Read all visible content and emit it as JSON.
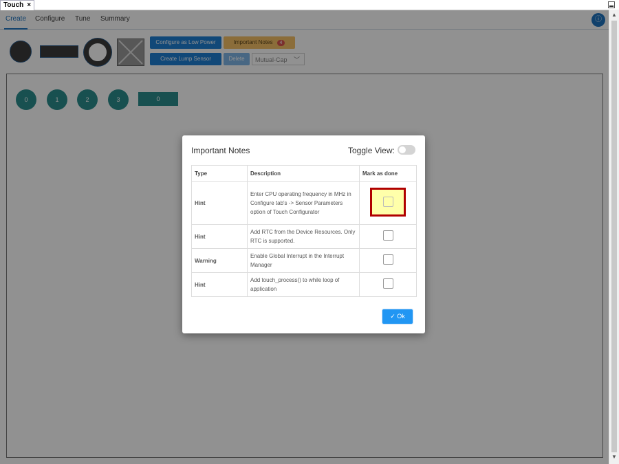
{
  "window": {
    "tab_title": "Touch",
    "tab_close": "×"
  },
  "nav": {
    "tabs": [
      {
        "label": "Create"
      },
      {
        "label": "Configure"
      },
      {
        "label": "Tune"
      },
      {
        "label": "Summary"
      }
    ],
    "active_tab": "Create",
    "info_icon": "ⓘ"
  },
  "toolbar": {
    "configure_low_power": "Configure as Low Power",
    "important_notes": "Important Notes",
    "important_notes_count": "4",
    "create_lump_sensor": "Create Lump Sensor",
    "delete": "Delete",
    "sensor_type": "Mutual-Cap",
    "shapes": [
      "button-sensor-icon",
      "slider-sensor-icon",
      "wheel-sensor-icon",
      "surface-sensor-icon"
    ]
  },
  "canvas": {
    "nodes": [
      "0",
      "1",
      "2",
      "3"
    ],
    "slider_label": "0"
  },
  "modal": {
    "title": "Important Notes",
    "toggle_label": "Toggle View:",
    "columns": [
      "Type",
      "Description",
      "Mark as done"
    ],
    "rows": [
      {
        "type": "Hint",
        "description": "Enter CPU operating frequency in MHz in Configure tab's -> Sensor Parameters option of Touch Configurator",
        "done": false
      },
      {
        "type": "Hint",
        "description": "Add RTC from the Device Resources. Only RTC is supported.",
        "done": false
      },
      {
        "type": "Warning",
        "description": "Enable Global Interrupt in the Interrupt Manager",
        "done": false
      },
      {
        "type": "Hint",
        "description": "Add touch_process() to while loop of application",
        "done": false
      }
    ],
    "ok_label": "Ok",
    "ok_icon": "✓"
  },
  "colors": {
    "accent": "#1e73be",
    "node": "#2b8e8e",
    "warning_button": "#f5c066",
    "highlight_border": "#b00000",
    "highlight_fill": "#ffffaa"
  }
}
